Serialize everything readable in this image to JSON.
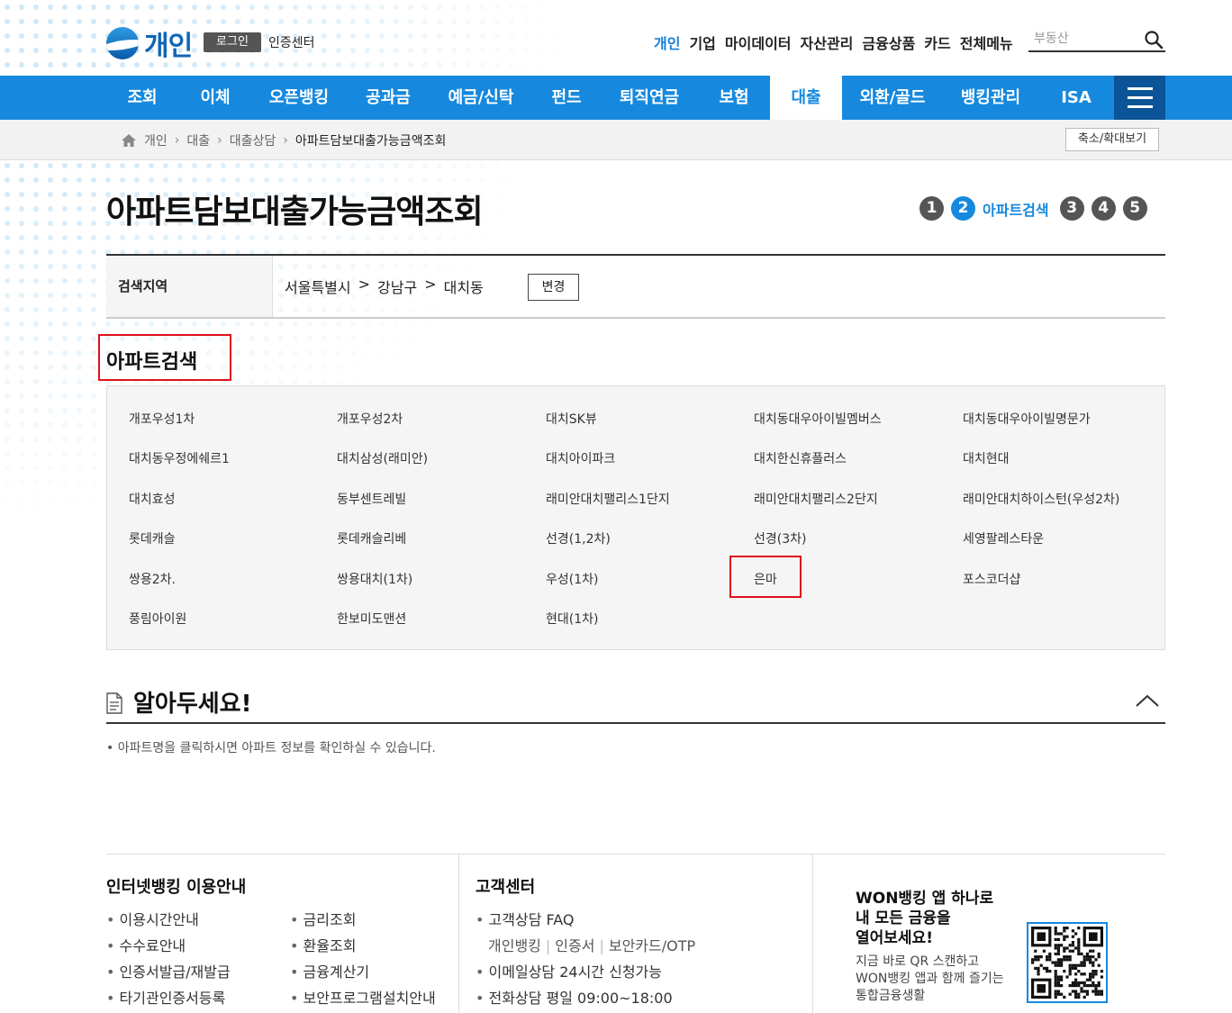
{
  "header": {
    "logo_text": "개인",
    "login_label": "로그인",
    "cert_center_label": "인증센터",
    "topnav": [
      "개인",
      "기업",
      "마이데이터",
      "자산관리",
      "금융상품",
      "카드",
      "전체메뉴"
    ],
    "search_placeholder": "부동산"
  },
  "mainnav": {
    "items": [
      "조회",
      "이체",
      "오픈뱅킹",
      "공과금",
      "예금/신탁",
      "펀드",
      "퇴직연금",
      "보험",
      "대출",
      "외환/골드",
      "뱅킹관리",
      "ISA"
    ],
    "active": "대출"
  },
  "breadcrumb": {
    "items": [
      "개인",
      "대출",
      "대출상담",
      "아파트담보대출가능금액조회"
    ],
    "zoom_label": "축소/확대보기"
  },
  "page": {
    "title": "아파트담보대출가능금액조회",
    "steps": [
      "1",
      "2",
      "3",
      "4",
      "5"
    ],
    "active_step_label": "아파트검색"
  },
  "region": {
    "label": "검색지역",
    "path": [
      "서울특별시",
      ">",
      "강남구",
      ">",
      "대치동"
    ],
    "change_label": "변경"
  },
  "apartments": {
    "title": "아파트검색",
    "items": [
      "개포우성1차",
      "개포우성2차",
      "대치SK뷰",
      "대치동대우아이빌멤버스",
      "대치동대우아이빌명문가",
      "대치동우정에쉐르1",
      "대치삼성(래미안)",
      "대치아이파크",
      "대치한신휴플러스",
      "대치현대",
      "대치효성",
      "동부센트레빌",
      "래미안대치팰리스1단지",
      "래미안대치팰리스2단지",
      "래미안대치하이스턴(우성2차)",
      "롯데캐슬",
      "롯데캐슬리베",
      "선경(1,2차)",
      "선경(3차)",
      "세영팔레스타운",
      "쌍용2차.",
      "쌍용대치(1차)",
      "우성(1차)",
      "은마",
      "포스코더샵",
      "풍림아이원",
      "한보미도맨션",
      "현대(1차)"
    ]
  },
  "notice": {
    "title": "알아두세요!",
    "text": "• 아파트명을 클릭하시면 아파트 정보를 확인하실 수 있습니다."
  },
  "footer": {
    "col1": {
      "title": "인터넷뱅킹 이용안내",
      "left": [
        "이용시간안내",
        "수수료안내",
        "인증서발급/재발급",
        "타기관인증서등록"
      ],
      "right": [
        "금리조회",
        "환율조회",
        "금융계산기",
        "보안프로그램설치안내"
      ]
    },
    "col2": {
      "title": "고객센터",
      "faq": "고객상담 FAQ",
      "sub": [
        "개인뱅킹",
        "인증서",
        "보안카드/OTP"
      ],
      "email": "이메일상담 24시간 신청가능",
      "phone": "전화상담 평일 09:00~18:00"
    },
    "col3": {
      "title_lines": [
        "WON뱅킹 앱 하나로",
        "내 모든 금융을",
        "열어보세요!"
      ],
      "desc_lines": [
        "지금 바로 QR 스캔하고",
        "WON뱅킹 앱과 함께 즐기는",
        "통합금융생활"
      ]
    }
  },
  "colors": {
    "brand_blue": "#1689de",
    "dark_blue": "#0a5497",
    "highlight_red": "#e0111a"
  }
}
